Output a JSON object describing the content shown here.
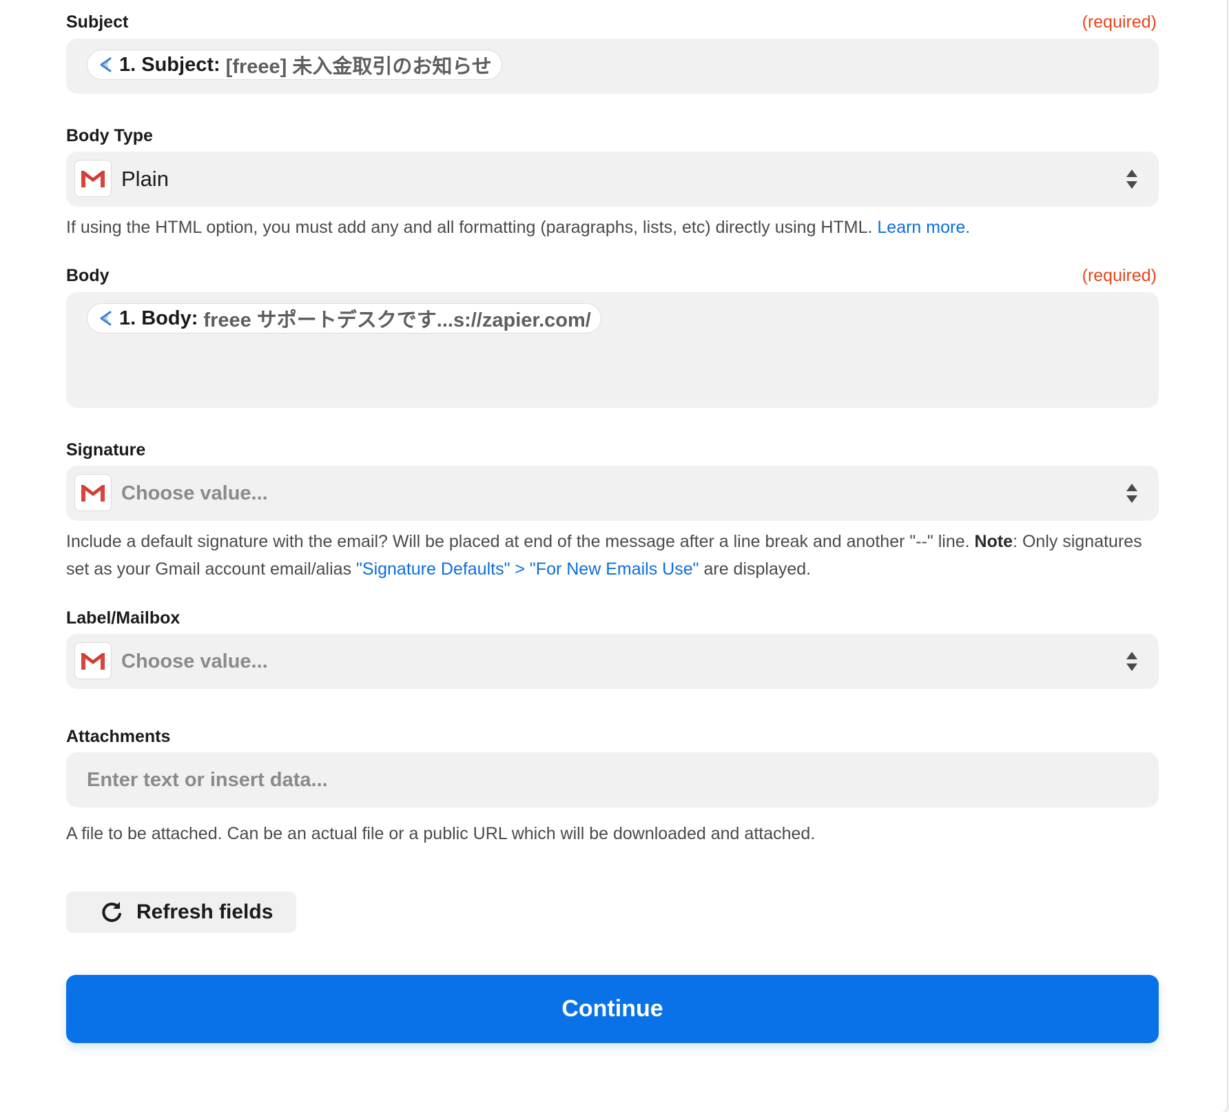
{
  "colors": {
    "accent": "#0972e8",
    "required": "#e5461c",
    "link": "#0b6ee0",
    "field_bg": "#f1f1f1"
  },
  "subject": {
    "label": "Subject",
    "required": "(required)",
    "pill_key": "1. Subject:",
    "pill_value": "[freee] 未入金取引のお知らせ"
  },
  "body_type": {
    "label": "Body Type",
    "value": "Plain",
    "help_text": "If using the HTML option, you must add any and all formatting (paragraphs, lists, etc) directly using HTML.",
    "help_link": "Learn more."
  },
  "body": {
    "label": "Body",
    "required": "(required)",
    "pill_key": "1. Body:",
    "pill_value": "freee サポートデスクです...s://zapier.com/"
  },
  "signature": {
    "label": "Signature",
    "placeholder": "Choose value...",
    "help_part1": "Include a default signature with the email? Will be placed at end of the message after a line break and another \"--\" line.",
    "help_note": "Note",
    "help_part2": ": Only signatures set as your Gmail account email/alias",
    "help_link": "\"Signature Defaults\" > \"For New Emails Use\"",
    "help_part3": "are displayed."
  },
  "label_mailbox": {
    "label": "Label/Mailbox",
    "placeholder": "Choose value..."
  },
  "attachments": {
    "label": "Attachments",
    "placeholder": "Enter text or insert data...",
    "help_text": "A file to be attached. Can be an actual file or a public URL which will be downloaded and attached."
  },
  "buttons": {
    "refresh_label": "Refresh fields",
    "continue_label": "Continue"
  },
  "icons": {
    "pill_icon": "zapier-step-icon",
    "app_icon": "gmail-icon",
    "select_icon": "sort-arrows-icon",
    "refresh_icon": "refresh-icon"
  }
}
